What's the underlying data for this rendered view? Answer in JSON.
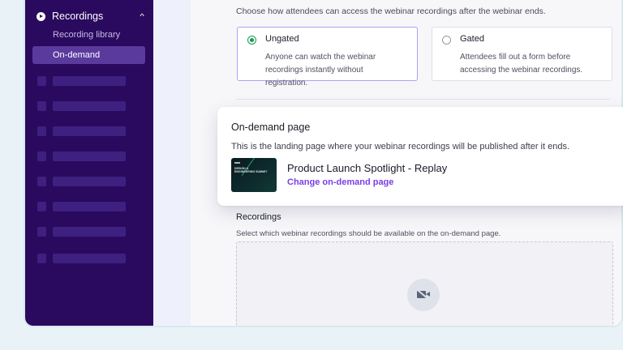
{
  "sidebar": {
    "section_label": "Recordings",
    "section_icon": "play-circle-icon",
    "collapse_icon": "chevron-up-icon",
    "items": [
      {
        "label": "Recording library"
      },
      {
        "label": "On-demand"
      }
    ],
    "active_item": "On-demand"
  },
  "access": {
    "intro": "Choose how attendees can access the webinar recordings after the webinar ends.",
    "options": [
      {
        "title": "Ungated",
        "desc_line1": "Anyone can watch the webinar",
        "desc_line2": "recordings instantly without registration.",
        "selected": true
      },
      {
        "title": "Gated",
        "desc_line1": "Attendees fill out a form before",
        "desc_line2": "accessing the webinar recordings.",
        "selected": false
      }
    ]
  },
  "on_demand": {
    "title": "On-demand page",
    "description": "This is the landing page where your webinar recordings will be published after it ends.",
    "thumbnail_line1": "DESIGN &",
    "thumbnail_line2": "ENGINEERING SUMMIT",
    "page_name": "Product Launch Spotlight - Replay",
    "change_link": "Change on-demand page"
  },
  "recordings": {
    "title": "Recordings",
    "description": "Select which webinar recordings should be available on the on-demand page.",
    "empty_icon": "video-off-icon"
  },
  "colors": {
    "sidebar_bg": "#2a0a5e",
    "active_item_bg": "#5b3a9e",
    "accent": "#7a3ee6",
    "radio_selected": "#159a4d"
  }
}
